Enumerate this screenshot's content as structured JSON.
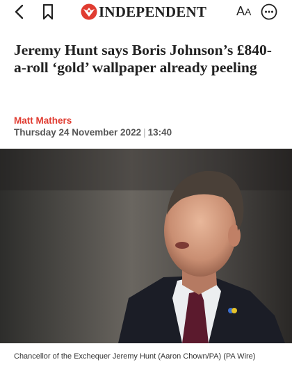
{
  "topbar": {
    "back_icon": "chevron-left-icon",
    "bookmark_icon": "bookmark-icon",
    "brand_name": "INDEPENDENT",
    "brand_logo": "eagle-logo",
    "brand_color": "#e03c31",
    "text_size_large": "A",
    "text_size_small": "A",
    "more_icon": "more-options-icon"
  },
  "article": {
    "headline": "Jeremy Hunt says Boris Johnson’s £840-a-roll ‘gold’ wallpaper already peeling",
    "author": "Matt Mathers",
    "author_color": "#e03c31",
    "date": "Thursday 24 November 2022",
    "time": "13:40",
    "date_separator": "|",
    "image_caption": "Chancellor of the Exchequer Jeremy Hunt (Aaron Chown/PA) (PA Wire)"
  }
}
